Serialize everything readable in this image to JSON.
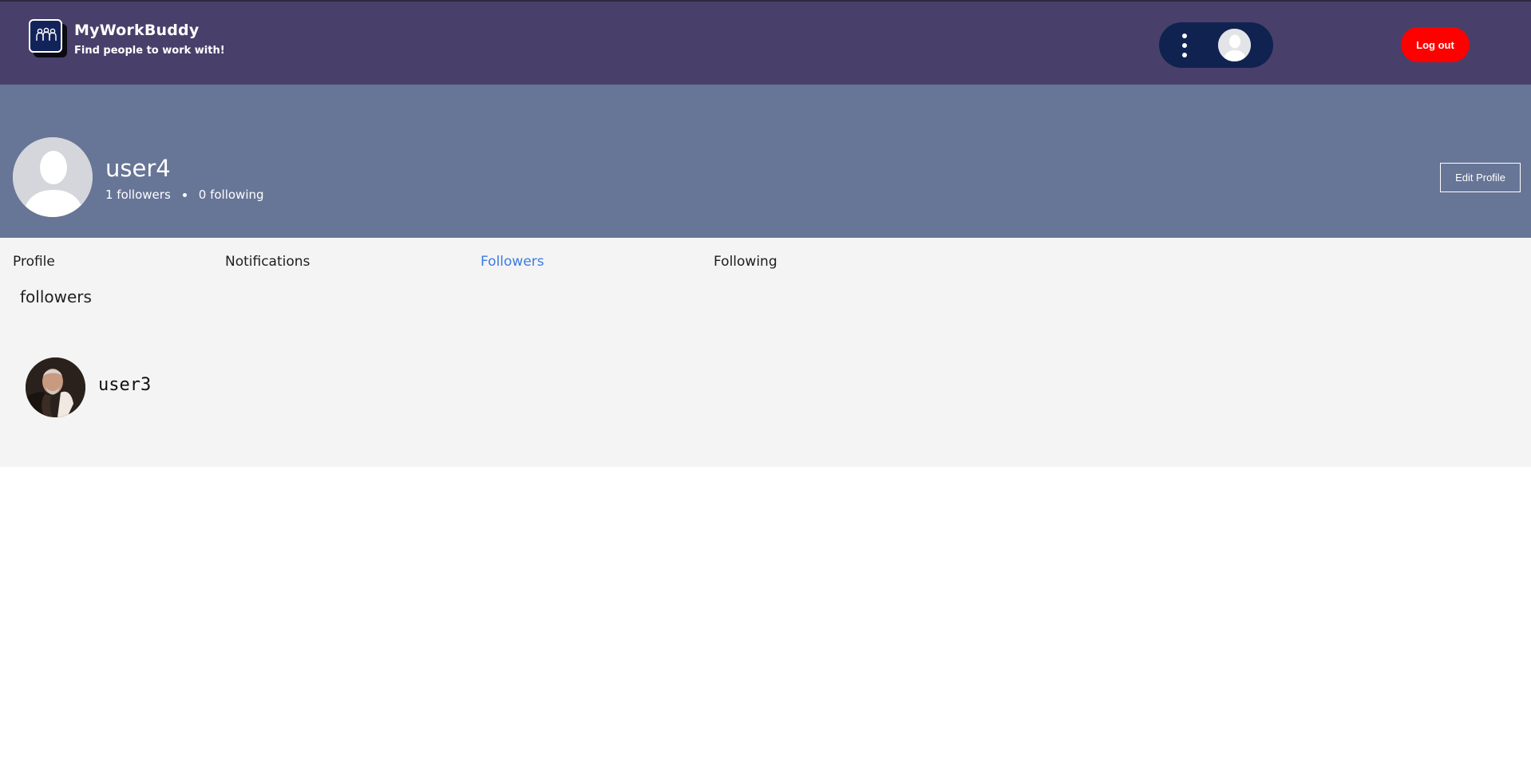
{
  "header": {
    "brand_title": "MyWorkBuddy",
    "brand_subtitle": "Find people to work with!",
    "logout_label": "Log out",
    "menu_icon": "kebab-menu-icon",
    "colors": {
      "bar": "#48406a",
      "pill": "#10224f",
      "logout": "#ff0000"
    }
  },
  "profile": {
    "username": "user4",
    "followers_text": "1 followers",
    "following_text": "0 following",
    "edit_label": "Edit Profile",
    "banner_color": "#677596"
  },
  "tabs": [
    {
      "label": "Profile",
      "active": false
    },
    {
      "label": "Notifications",
      "active": false
    },
    {
      "label": "Followers",
      "active": true
    },
    {
      "label": "Following",
      "active": false
    }
  ],
  "section": {
    "title": "followers"
  },
  "followers": [
    {
      "username": "user3"
    }
  ],
  "accent_color": "#3d7be0"
}
